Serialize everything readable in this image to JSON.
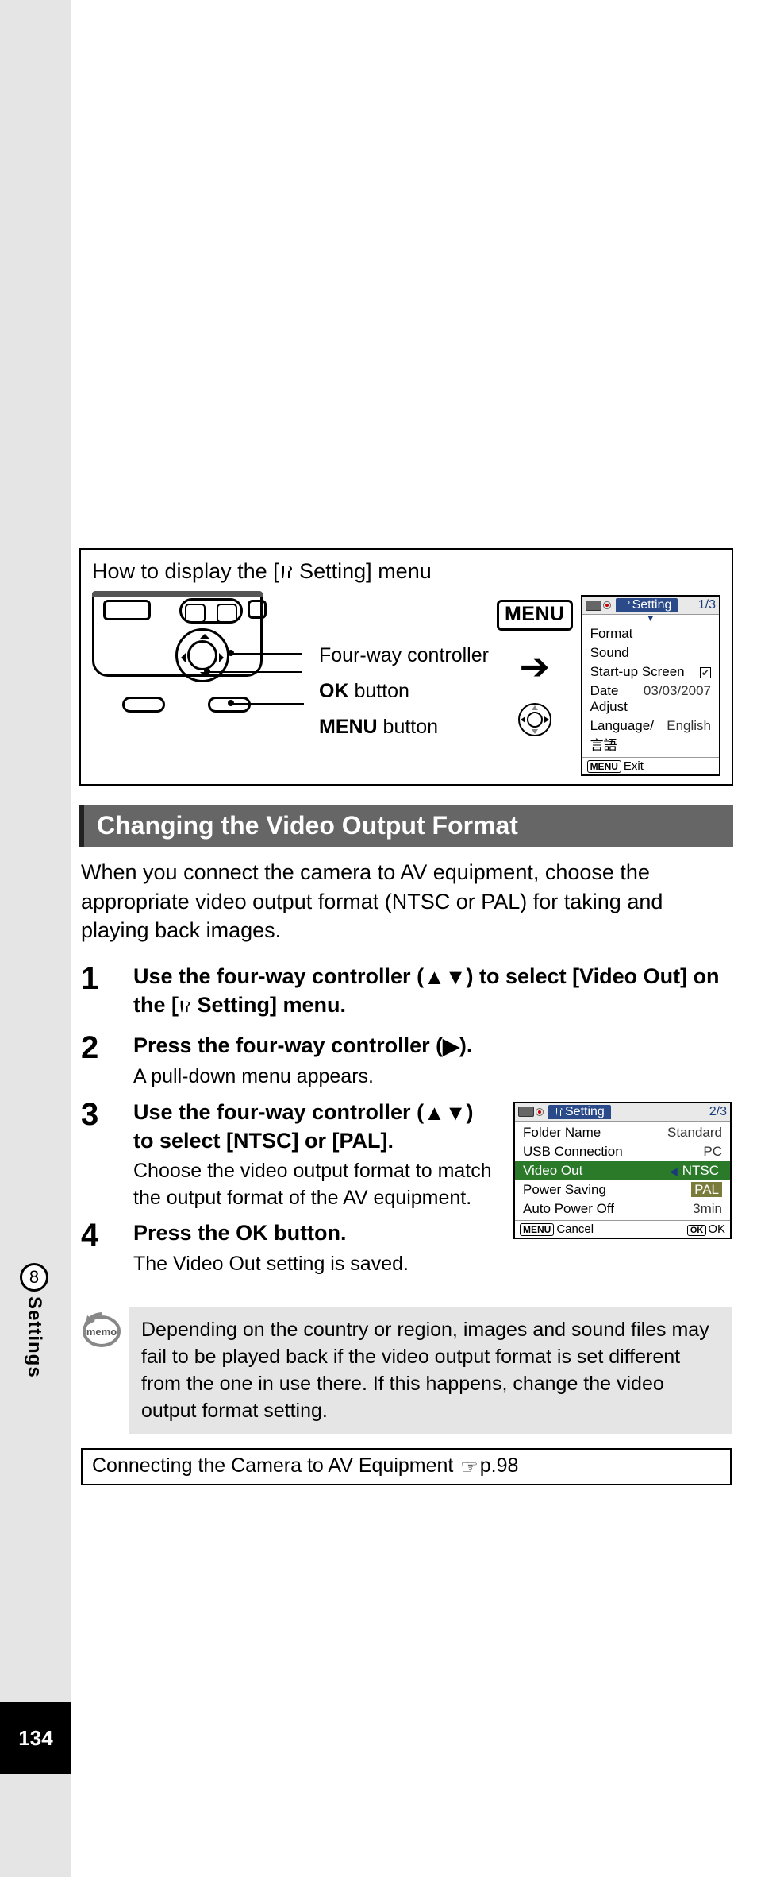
{
  "side": {
    "chapter_num": "8",
    "chapter_label": "Settings",
    "page_num": "134"
  },
  "diagram": {
    "caption_pre": "How to display the [",
    "caption_post": " Setting] menu",
    "label_fourway": "Four-way controller",
    "label_ok_pre": "",
    "label_ok_bold": "OK",
    "label_ok_post": " button",
    "label_menu_bold": "MENU",
    "label_menu_post": " button",
    "menu_box": "MENU"
  },
  "lcd1": {
    "tab": "Setting",
    "page": "1/3",
    "rows": [
      {
        "k": "Format",
        "v": ""
      },
      {
        "k": "Sound",
        "v": ""
      },
      {
        "k": "Start-up Screen",
        "v": "�check"
      },
      {
        "k": "Date Adjust",
        "v": "03/03/2007"
      },
      {
        "k": "Language/言語",
        "v": "English"
      }
    ],
    "foot_left": "Exit"
  },
  "section_title": "Changing the Video Output Format",
  "intro": "When you connect the camera to AV equipment, choose the appropriate video output format (NTSC or PAL) for taking and playing back images.",
  "steps": {
    "s1": {
      "num": "1",
      "title_pre": "Use the four-way controller (",
      "title_post": ") to select [Video Out] on the [",
      "title_end": " Setting] menu."
    },
    "s2": {
      "num": "2",
      "title_pre": "Press the four-way controller (",
      "title_post": ").",
      "sub": "A pull-down menu appears."
    },
    "s3": {
      "num": "3",
      "title_pre": "Use the four-way controller (",
      "title_post": ") to select [NTSC] or [PAL].",
      "sub": "Choose the video output format to match the output format of the AV equipment."
    },
    "s4": {
      "num": "4",
      "title_pre": "Press the ",
      "title_bold": "OK",
      "title_post": " button.",
      "sub": "The Video Out setting is saved."
    }
  },
  "lcd2": {
    "tab": "Setting",
    "page": "2/3",
    "rows": [
      {
        "k": "Folder Name",
        "v": "Standard"
      },
      {
        "k": "USB Connection",
        "v": "PC"
      },
      {
        "k": "Video Out",
        "v": "NTSC",
        "sel": true,
        "alt": "PAL"
      },
      {
        "k": "Power Saving",
        "v": ""
      },
      {
        "k": "Auto Power Off",
        "v": "3min"
      }
    ],
    "foot_left": "Cancel",
    "foot_right": "OK"
  },
  "memo": "Depending on the country or region, images and sound files may fail to be played back if the video output format is set different from the one in use there. If this happens, change the video output format setting.",
  "ref": {
    "text": "Connecting the Camera to AV Equipment ",
    "page": "p.98"
  }
}
